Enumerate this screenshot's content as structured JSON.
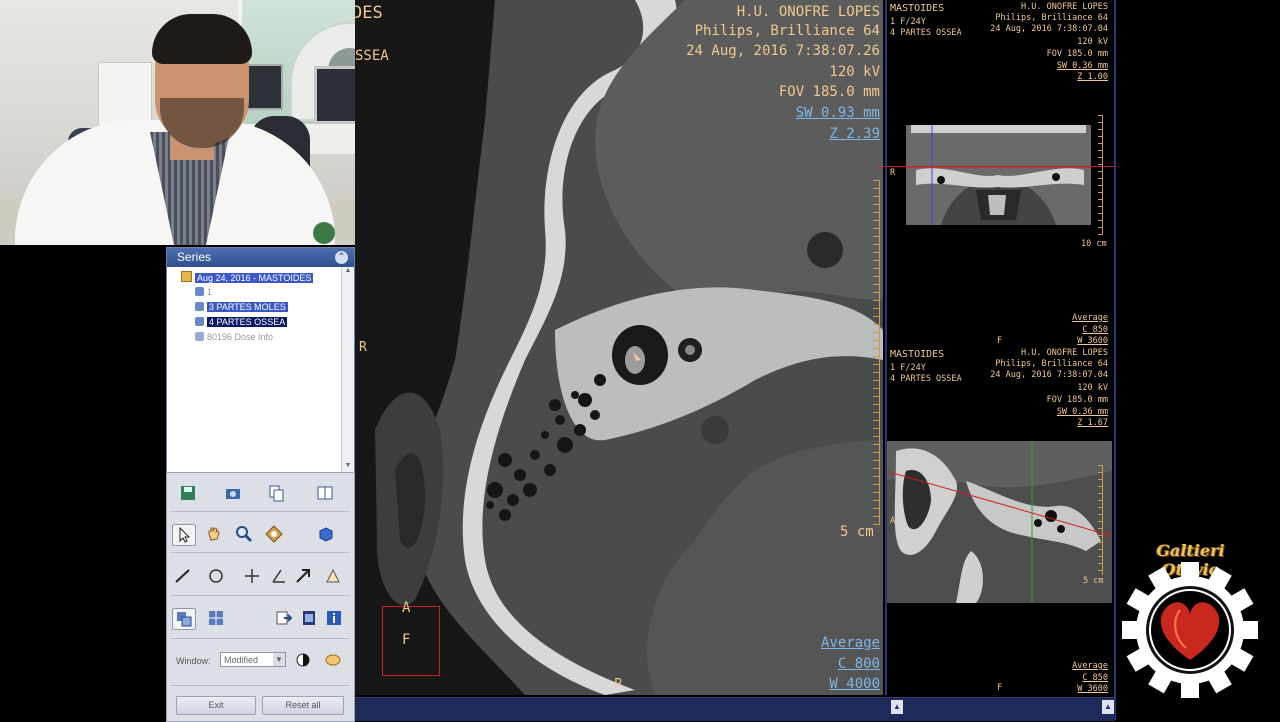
{
  "series_panel": {
    "title": "Series",
    "study": "Aug 24, 2016 - MASTOIDES",
    "items": [
      {
        "label": "1",
        "state": "dim"
      },
      {
        "label": "3  PARTES MOLES",
        "state": "selected"
      },
      {
        "label": "4  PARTES OSSEA",
        "state": "active"
      },
      {
        "label": "80196  Dose Info",
        "state": "dim"
      }
    ]
  },
  "toolbox": {
    "window_label": "Window:",
    "window_value": "Modified",
    "exit_label": "Exit",
    "reset_label": "Reset all"
  },
  "main_view": {
    "institution": "H.U. ONOFRE LOPES",
    "scanner": "Philips, Brilliance 64",
    "datetime": "24 Aug, 2016 7:38:07.26",
    "kv": "120 kV",
    "fov": "FOV 185.0 mm",
    "sw": "SW 0.93 mm",
    "z": "Z 2.39",
    "scale": "5 cm",
    "wl_mode": "Average",
    "center": "C    800",
    "width": "W  4000",
    "orient_left": "R",
    "orient_bottom": "P",
    "orient_box_top": "A",
    "orient_box_bottom": "F",
    "top_left_partial_1": "DES",
    "top_left_partial_2": "SSEA"
  },
  "panel_coronal": {
    "study": "MASTOIDES",
    "patient": "1 F/24Y",
    "series": "4 PARTES OSSEA",
    "institution": "H.U. ONOFRE LOPES",
    "scanner": "Philips, Brilliance 64",
    "datetime": "24 Aug, 2016 7:38:07.04",
    "kv": "120 kV",
    "fov": "FOV 185.0 mm",
    "sw": "SW 0.36 mm",
    "z": "Z 1.00",
    "scale": "10 cm",
    "orient_left": "R",
    "orient_bottom": "F",
    "wl_mode": "Average",
    "center": "C   850",
    "width": "W  3600"
  },
  "panel_sagittal": {
    "study": "MASTOIDES",
    "patient": "1 F/24Y",
    "series": "4 PARTES OSSEA",
    "institution": "H.U. ONOFRE LOPES",
    "scanner": "Philips, Brilliance 64",
    "datetime": "24 Aug, 2016 7:38:07.04",
    "kv": "120 kV",
    "fov": "FOV 185.0 mm",
    "sw": "SW 0.36 mm",
    "z": "Z 1.67",
    "scale": "5 cm",
    "orient_left": "A",
    "orient_bottom": "F",
    "wl_mode": "Average",
    "center": "C   850",
    "width": "W  3600"
  },
  "watermark": {
    "title": "Galtieri Otávio"
  },
  "colors": {
    "overlay_text": "#f0c890",
    "overlay_link": "#7fb6e6",
    "series_title_bar": "#2f4f8f",
    "selection": "#3a58c8",
    "bottom_bar": "#1d2a5a",
    "orientation_box": "#d02020"
  },
  "icons": [
    "save-icon",
    "camera-icon",
    "copy-icon",
    "report-icon",
    "pointer-icon",
    "hand-icon",
    "zoom-icon",
    "window-level-icon",
    "cube-icon",
    "line-icon",
    "ellipse-icon",
    "crosshair-icon",
    "angle-icon",
    "arrow-icon",
    "roi-icon",
    "layout-icon",
    "grid-icon",
    "export-icon",
    "film-icon",
    "info-icon",
    "invert-icon",
    "palette-icon"
  ]
}
